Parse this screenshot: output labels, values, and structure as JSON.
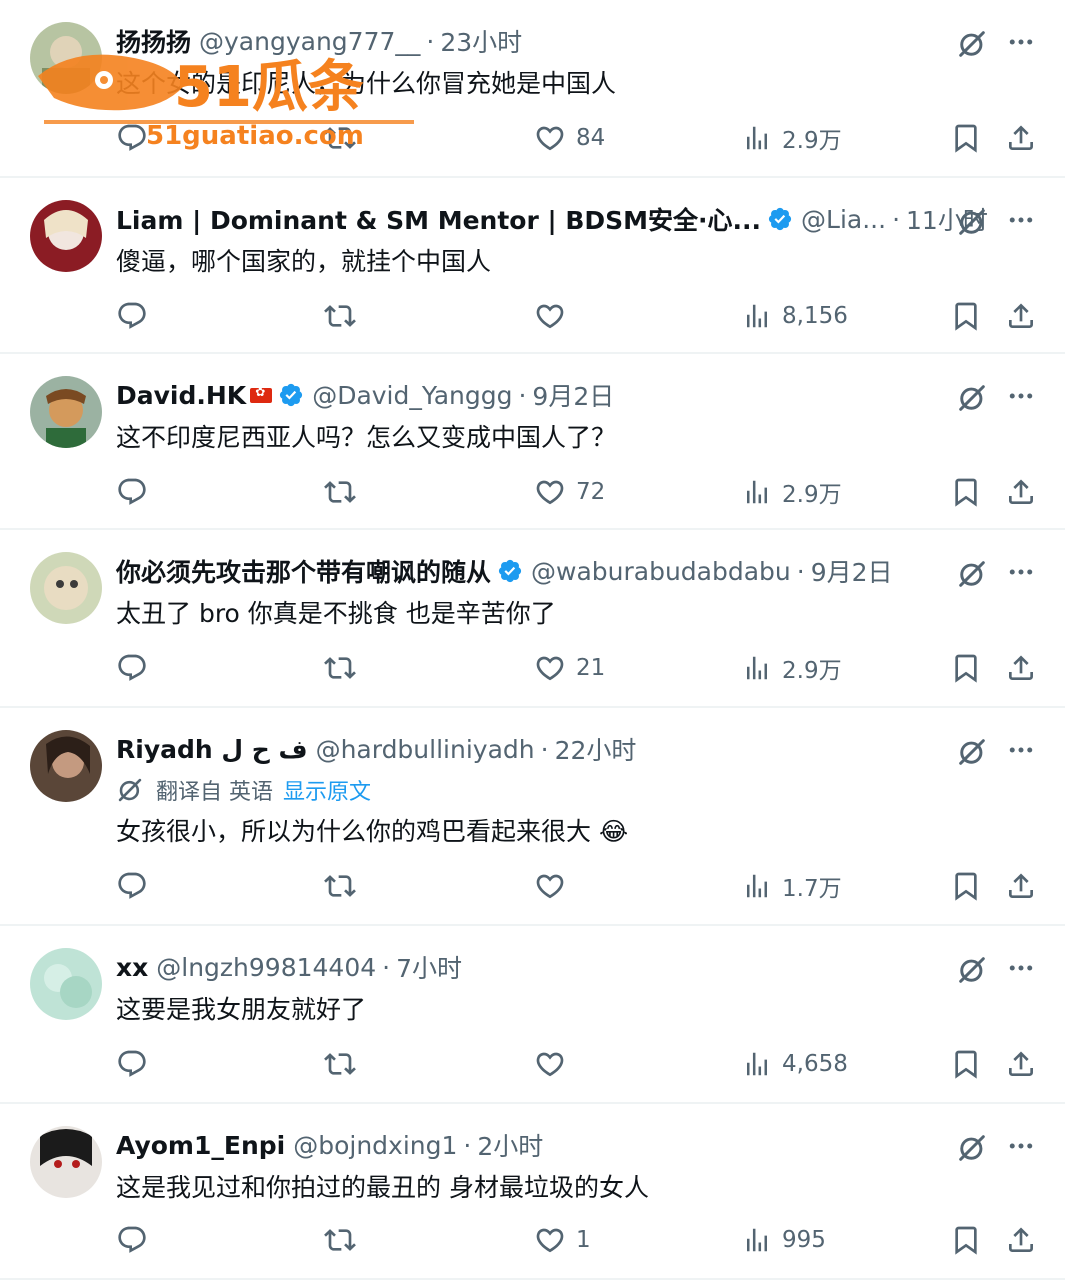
{
  "tweets": [
    {
      "name": "扬扬扬",
      "handle": "@yangyang777__",
      "time": "23小时",
      "verified": false,
      "flag": false,
      "text": "这个女的是印尼人，为什么你冒充她是中国人",
      "likes": "84",
      "views": "2.9万"
    },
    {
      "name": "Liam | Dominant & SM Mentor | BDSM安全·心...",
      "handle": "@Lia...",
      "time": "11小时",
      "verified": true,
      "flag": false,
      "text": "傻逼，哪个国家的，就挂个中国人",
      "likes": "",
      "views": "8,156"
    },
    {
      "name": "David.HK",
      "handle": "@David_Yanggg",
      "time": "9月2日",
      "verified": true,
      "flag": true,
      "text": "这不印度尼西亚人吗？怎么又变成中国人了？",
      "likes": "72",
      "views": "2.9万"
    },
    {
      "name": "你必须先攻击那个带有嘲讽的随从",
      "handle": "@waburabudabdabu",
      "time": "9月2日",
      "verified": true,
      "flag": false,
      "text": "太丑了 bro 你真是不挑食 也是辛苦你了",
      "likes": "21",
      "views": "2.9万"
    },
    {
      "name": "Riyadh ف ح ل",
      "handle": "@hardbulliniyadh",
      "time": "22小时",
      "verified": false,
      "flag": false,
      "translate_note": "翻译自 英语",
      "translate_link": "显示原文",
      "text": "女孩很小，所以为什么你的鸡巴看起来很大 😂",
      "likes": "",
      "views": "1.7万"
    },
    {
      "name": "xx",
      "handle": "@lngzh99814404",
      "time": "7小时",
      "verified": false,
      "flag": false,
      "text": "这要是我女朋友就好了",
      "likes": "",
      "views": "4,658"
    },
    {
      "name": "Ayom1_Enpi",
      "handle": "@bojndxing1",
      "time": "2小时",
      "verified": false,
      "flag": false,
      "text": "这是我见过和你拍过的最丑的 身材最垃圾的女人",
      "likes": "1",
      "views": "995"
    }
  ],
  "watermark": {
    "brand": "51瓜条",
    "url": "51guatiao.com"
  },
  "colors": {
    "text": "#0f1419",
    "muted": "#536471",
    "link": "#1d9bf0",
    "verified": "#1d9bf0",
    "divider": "#eff3f4",
    "watermark": "#f5821f"
  }
}
